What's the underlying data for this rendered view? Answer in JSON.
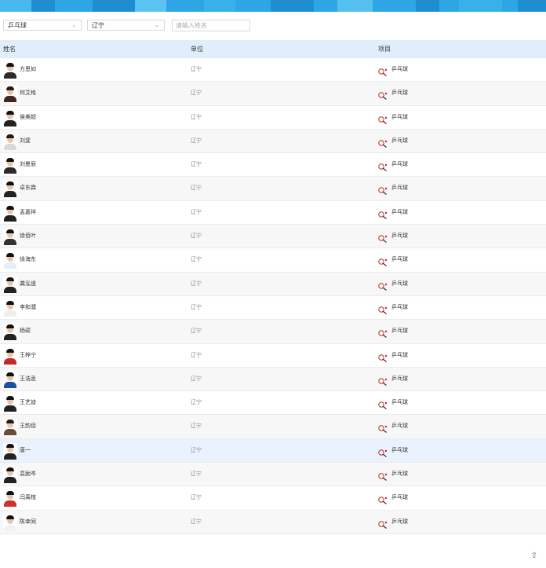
{
  "colors": {
    "accent": "#2ea6e6",
    "header_bg": "#e0eefc",
    "row_alt": "#f7f7f7",
    "row_highlight": "#eaf3fd"
  },
  "filters": {
    "sport_select": "乒乓球",
    "unit_select": "辽宁",
    "name_placeholder": "请输入姓名"
  },
  "table": {
    "headers": {
      "name": "姓名",
      "unit": "单位",
      "sport": "项目"
    },
    "rows": [
      {
        "name": "方思如",
        "unit": "辽宁",
        "sport": "乒乓球",
        "shirt": "#2b2b2b",
        "hair": "#111"
      },
      {
        "name": "何艾格",
        "unit": "辽宁",
        "sport": "乒乓球",
        "shirt": "#3a2a22",
        "hair": "#2a1a10"
      },
      {
        "name": "侯美超",
        "unit": "辽宁",
        "sport": "乒乓球",
        "shirt": "#222",
        "hair": "#111"
      },
      {
        "name": "刘斐",
        "unit": "辽宁",
        "sport": "乒乓球",
        "shirt": "#d9d9d9",
        "hair": "#2a1a10"
      },
      {
        "name": "刘曼辰",
        "unit": "辽宁",
        "sport": "乒乓球",
        "shirt": "#2b2b2b",
        "hair": "#111"
      },
      {
        "name": "卓东霖",
        "unit": "辽宁",
        "sport": "乒乓球",
        "shirt": "#222",
        "hair": "#111"
      },
      {
        "name": "孟嘉祥",
        "unit": "辽宁",
        "sport": "乒乓球",
        "shirt": "#222",
        "hair": "#111"
      },
      {
        "name": "徐佰叶",
        "unit": "辽宁",
        "sport": "乒乓球",
        "shirt": "#333",
        "hair": "#111"
      },
      {
        "name": "徐海东",
        "unit": "辽宁",
        "sport": "乒乓球",
        "shirt": "#e8eef5",
        "hair": "#111"
      },
      {
        "name": "龚泓道",
        "unit": "辽宁",
        "sport": "乒乓球",
        "shirt": "#222",
        "hair": "#111"
      },
      {
        "name": "李和濮",
        "unit": "辽宁",
        "sport": "乒乓球",
        "shirt": "#eeeeee",
        "hair": "#111"
      },
      {
        "name": "杨硕",
        "unit": "辽宁",
        "sport": "乒乓球",
        "shirt": "#222",
        "hair": "#111"
      },
      {
        "name": "王梓宁",
        "unit": "辽宁",
        "sport": "乒乓球",
        "shirt": "#c62828",
        "hair": "#111"
      },
      {
        "name": "王浩丞",
        "unit": "辽宁",
        "sport": "乒乓球",
        "shirt": "#1d4fa3",
        "hair": "#111"
      },
      {
        "name": "王艺迪",
        "unit": "辽宁",
        "sport": "乒乓球",
        "shirt": "#222",
        "hair": "#111"
      },
      {
        "name": "王韵佰",
        "unit": "辽宁",
        "sport": "乒乓球",
        "shirt": "#6a4a3a",
        "hair": "#2a1a10"
      },
      {
        "name": "唐一",
        "unit": "辽宁",
        "sport": "乒乓球",
        "shirt": "#222",
        "hair": "#111"
      },
      {
        "name": "袁励岑",
        "unit": "辽宁",
        "sport": "乒乓球",
        "shirt": "#222",
        "hair": "#111"
      },
      {
        "name": "闫禹楦",
        "unit": "辽宁",
        "sport": "乒乓球",
        "shirt": "#d32f2f",
        "hair": "#111"
      },
      {
        "name": "陈幸同",
        "unit": "辽宁",
        "sport": "乒乓球",
        "shirt": "#f2f2f2",
        "hair": "#111"
      }
    ]
  }
}
